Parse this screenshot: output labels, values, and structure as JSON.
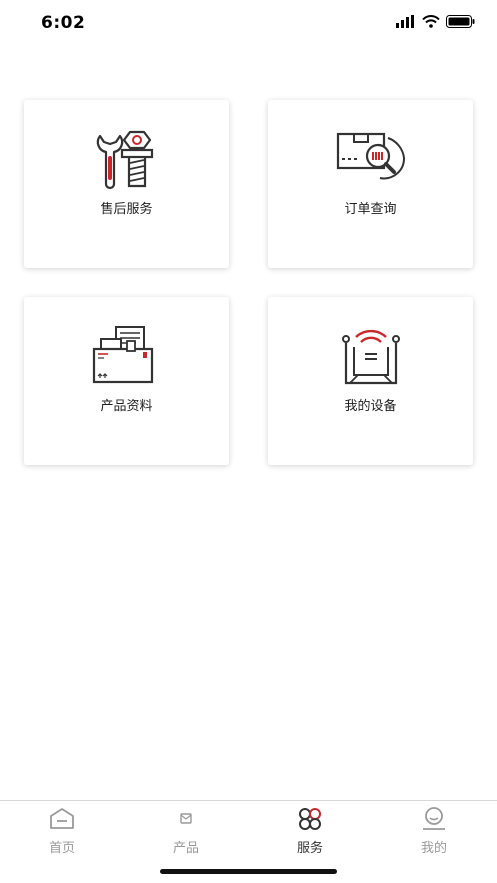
{
  "status_bar": {
    "time": "6:02"
  },
  "services": [
    {
      "label": "售后服务",
      "icon": "wrench-bolt-icon"
    },
    {
      "label": "订单查询",
      "icon": "package-search-icon"
    },
    {
      "label": "产品资料",
      "icon": "document-box-icon"
    },
    {
      "label": "我的设备",
      "icon": "wifi-device-icon"
    }
  ],
  "tabs": [
    {
      "label": "首页",
      "icon": "home-icon",
      "active": false
    },
    {
      "label": "产品",
      "icon": "product-icon",
      "active": false
    },
    {
      "label": "服务",
      "icon": "service-icon",
      "active": true
    },
    {
      "label": "我的",
      "icon": "profile-icon",
      "active": false
    }
  ],
  "colors": {
    "accent": "#c8282d",
    "ink": "#333333",
    "inactive": "#9a9a9a"
  }
}
